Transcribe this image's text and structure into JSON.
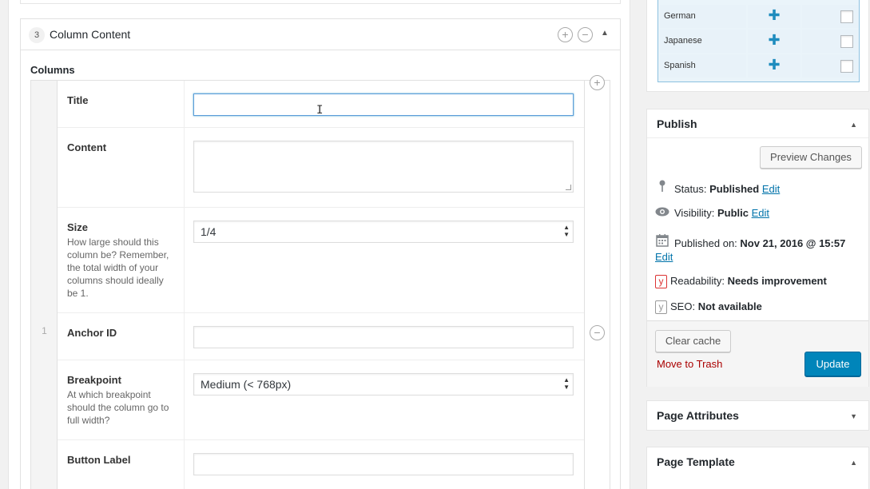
{
  "layout": {
    "order": "3",
    "title": "Column Content",
    "add_symbol": "+",
    "remove_symbol": "−",
    "toggle_symbol": "▲",
    "section_label": "Columns",
    "row_number": "1",
    "fields": [
      {
        "label": "Title",
        "type": "text",
        "value": "",
        "description": ""
      },
      {
        "label": "Content",
        "type": "textarea",
        "value": "",
        "description": ""
      },
      {
        "label": "Size",
        "type": "select",
        "value": "1/4",
        "description": "How large should this column be? Remember, the total width of your columns should ideally be 1."
      },
      {
        "label": "Anchor ID",
        "type": "text",
        "value": "",
        "description": ""
      },
      {
        "label": "Breakpoint",
        "type": "select",
        "value": "Medium (< 768px)",
        "description": "At which breakpoint should the column go to full width?"
      },
      {
        "label": "Button Label",
        "type": "text",
        "value": "",
        "description": ""
      }
    ]
  },
  "languages": {
    "rows": [
      {
        "name": "German",
        "add": "✚"
      },
      {
        "name": "Japanese",
        "add": "✚"
      },
      {
        "name": "Spanish",
        "add": "✚"
      }
    ]
  },
  "publish": {
    "title": "Publish",
    "toggle_symbol": "▲",
    "preview_label": "Preview Changes",
    "status_label": "Status:",
    "status_value": "Published",
    "visibility_label": "Visibility:",
    "visibility_value": "Public",
    "published_label": "Published on:",
    "published_value": "Nov 21, 2016 @ 15:57",
    "edit_label": "Edit",
    "readability_label": "Readability:",
    "readability_value": "Needs improvement",
    "seo_label": "SEO:",
    "seo_value": "Not available",
    "clear_cache_label": "Clear cache",
    "trash_label": "Move to Trash",
    "update_label": "Update"
  },
  "page_attributes": {
    "title": "Page Attributes",
    "toggle_symbol": "▼"
  },
  "page_template": {
    "title": "Page Template",
    "toggle_symbol": "▲"
  },
  "icons": {
    "pin": "pin-icon",
    "eye": "eye-icon",
    "calendar": "calendar-icon",
    "yoast": "yoast-icon"
  },
  "colors": {
    "link": "#0073aa",
    "primary_button": "#0085ba",
    "trash": "#aa0000",
    "focus": "#5b9dd9"
  }
}
